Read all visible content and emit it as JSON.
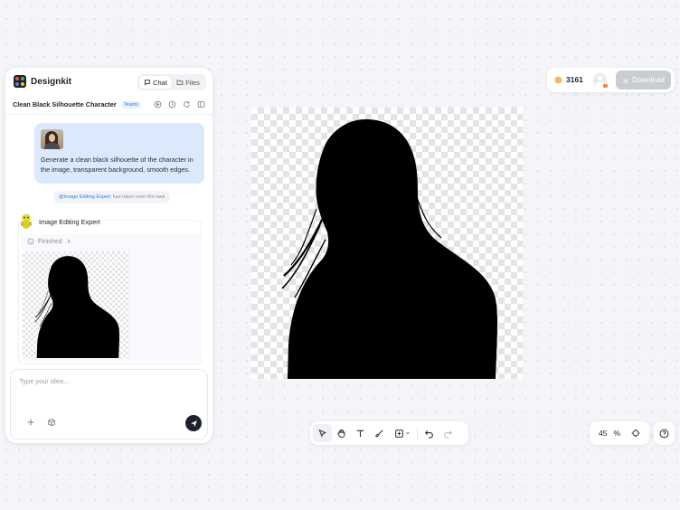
{
  "app": {
    "brand_name": "Designkit",
    "tabs": [
      {
        "label": "Chat",
        "icon": "chat-icon",
        "active": true
      },
      {
        "label": "Files",
        "icon": "folder-icon",
        "active": false
      }
    ]
  },
  "task": {
    "title": "Clean Black Silhouette Character",
    "badge": "Teams",
    "icons": [
      "play-circle-icon",
      "history-icon",
      "refresh-icon",
      "sidebar-icon"
    ]
  },
  "conversation": {
    "user_message": "Generate a clean black silhouette of the character in the image, transparent background, smooth edges.",
    "system_notice": {
      "mention": "@Image Editing Expert",
      "text": "has taken over the task"
    },
    "agent": {
      "name": "Image Editing Expert",
      "status": "Finished"
    }
  },
  "composer": {
    "placeholder": "Type your idea...",
    "value": ""
  },
  "topbar": {
    "credits": "3161",
    "download_label": "Download"
  },
  "toolbar": {
    "tools": [
      "select-tool",
      "hand-tool",
      "text-tool",
      "brush-tool",
      "add-frame-tool",
      "undo",
      "redo"
    ]
  },
  "zoom": {
    "value": "45",
    "unit": "%"
  },
  "colors": {
    "accent": "#2b7de9",
    "user_bubble": "#dbe9fd",
    "download_disabled": "#c9ccd2",
    "silhouette": "#000000"
  }
}
